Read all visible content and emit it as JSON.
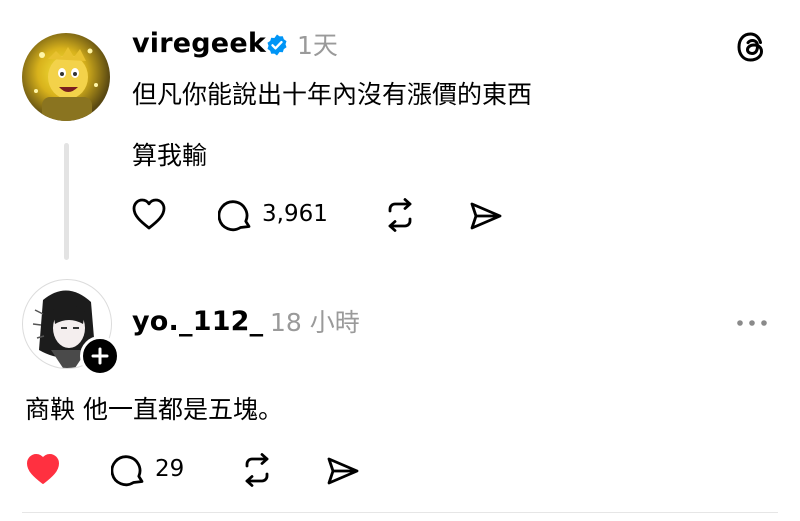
{
  "post": {
    "username": "viregeek",
    "timestamp": "1天",
    "text_line1": "但凡你能說出十年內沒有漲價的東西",
    "text_line2": "算我輸",
    "reply_count": "3,961",
    "icons": [
      "heart-icon",
      "comment-icon",
      "repost-icon",
      "share-icon",
      "threads-logo-icon",
      "verified-badge-icon"
    ]
  },
  "reply": {
    "username": "yo._112_",
    "timestamp": "18 小時",
    "text": "商鞅 他一直都是五塊。",
    "reply_count": "29",
    "liked": true,
    "icons": [
      "heart-filled-icon",
      "comment-icon",
      "repost-icon",
      "share-icon",
      "more-icon",
      "follow-plus-icon"
    ]
  },
  "colors": {
    "verified": "#0095f6",
    "liked": "#ff3040",
    "muted": "#9a9a9a",
    "thread_line": "#e3e3e3"
  }
}
